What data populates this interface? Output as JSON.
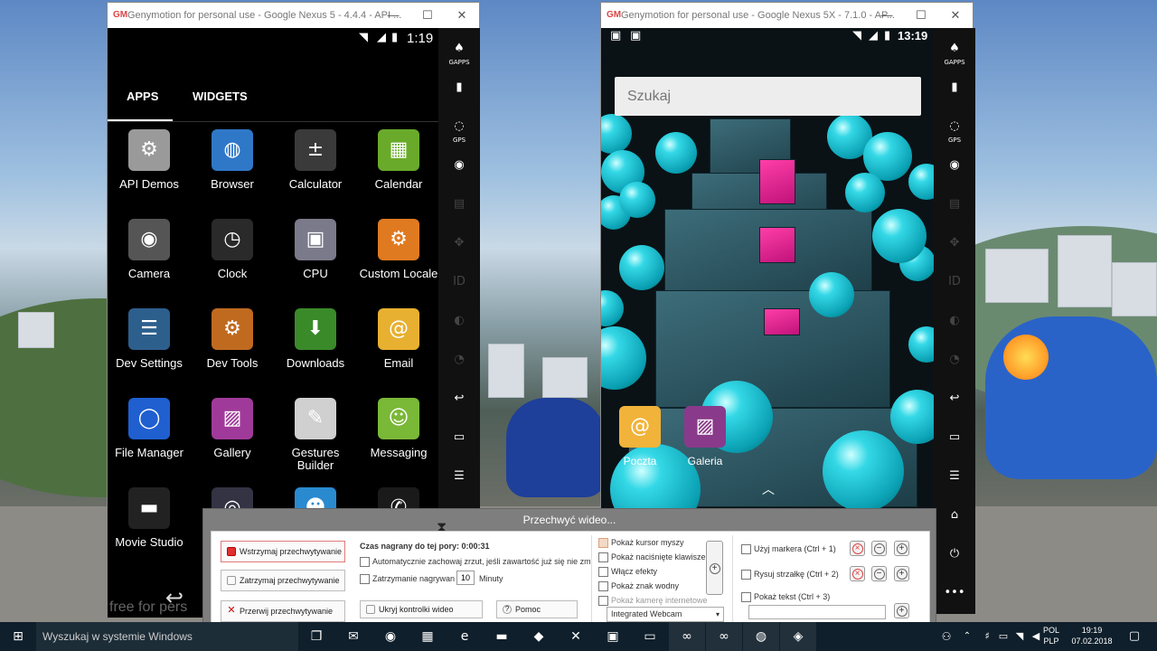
{
  "window_left": {
    "title": "Genymotion for personal use - Google Nexus 5 - 4.4.4 - API ...",
    "logo": "GM",
    "status_time": "1:19",
    "tabs": [
      "APPS",
      "WIDGETS"
    ],
    "apps": [
      {
        "label": "API Demos",
        "icon": "folder-gear-icon",
        "glyph": "⚙",
        "color": "#9a9a9a"
      },
      {
        "label": "Browser",
        "icon": "globe-icon",
        "glyph": "◍",
        "color": "#2f78c8"
      },
      {
        "label": "Calculator",
        "icon": "calculator-icon",
        "glyph": "±",
        "color": "#3a3a3a"
      },
      {
        "label": "Calendar",
        "icon": "calendar-icon",
        "glyph": "▦",
        "color": "#6aaa2a"
      },
      {
        "label": "Camera",
        "icon": "camera-icon",
        "glyph": "◉",
        "color": "#555"
      },
      {
        "label": "Clock",
        "icon": "clock-icon",
        "glyph": "◷",
        "color": "#2a2a2a"
      },
      {
        "label": "CPU",
        "icon": "cpu-icon",
        "glyph": "▣",
        "color": "#7a7a8a"
      },
      {
        "label": "Custom Locale",
        "icon": "locale-gear-icon",
        "glyph": "⚙",
        "color": "#e07a20"
      },
      {
        "label": "Dev Settings",
        "icon": "sliders-icon",
        "glyph": "☰",
        "color": "#2d5f8d"
      },
      {
        "label": "Dev Tools",
        "icon": "gear-icon",
        "glyph": "⚙",
        "color": "#c06a20"
      },
      {
        "label": "Downloads",
        "icon": "download-icon",
        "glyph": "⬇",
        "color": "#3a8a2a"
      },
      {
        "label": "Email",
        "icon": "email-icon",
        "glyph": "@",
        "color": "#e8b030"
      },
      {
        "label": "File Manager",
        "icon": "file-manager-icon",
        "glyph": "◯",
        "color": "#1f5fd0"
      },
      {
        "label": "Gallery",
        "icon": "gallery-icon",
        "glyph": "▨",
        "color": "#a03a9a"
      },
      {
        "label": "Gestures Builder",
        "icon": "gesture-icon",
        "glyph": "✎",
        "color": "#d0d0d0"
      },
      {
        "label": "Messaging",
        "icon": "messaging-icon",
        "glyph": "☺",
        "color": "#7ab838"
      },
      {
        "label": "Movie Studio",
        "icon": "clapperboard-icon",
        "glyph": "▬",
        "color": "#222"
      },
      {
        "label": "",
        "icon": "music-icon",
        "glyph": "◎",
        "color": "#334"
      },
      {
        "label": "",
        "icon": "contacts-icon",
        "glyph": "☻",
        "color": "#2a8ad0"
      },
      {
        "label": "",
        "icon": "phone-icon",
        "glyph": "✆",
        "color": "#1a1a1a"
      }
    ],
    "watermark": "free for pers",
    "sidebar": [
      {
        "icon": "gapps-icon",
        "glyph": "♠",
        "sub": "GAPPS",
        "dim": false
      },
      {
        "icon": "battery-icon",
        "glyph": "▮",
        "sub": "",
        "dim": false
      },
      {
        "icon": "gps-icon",
        "glyph": "◌",
        "sub": "GPS",
        "dim": false
      },
      {
        "icon": "webcam-icon",
        "glyph": "◉",
        "sub": "",
        "dim": false
      },
      {
        "icon": "clapper-icon",
        "glyph": "▤",
        "sub": "",
        "dim": true
      },
      {
        "icon": "dpad-icon",
        "glyph": "✥",
        "sub": "",
        "dim": true
      },
      {
        "icon": "id-icon",
        "glyph": "ID",
        "sub": "",
        "dim": true
      },
      {
        "icon": "disk-icon",
        "glyph": "◐",
        "sub": "",
        "dim": true
      },
      {
        "icon": "cast-icon",
        "glyph": "◔",
        "sub": "",
        "dim": true
      },
      {
        "icon": "back-icon",
        "glyph": "↩",
        "sub": "",
        "dim": false
      },
      {
        "icon": "recent-apps-icon",
        "glyph": "▭",
        "sub": "",
        "dim": false
      },
      {
        "icon": "menu-icon",
        "glyph": "☰",
        "sub": "",
        "dim": false
      }
    ]
  },
  "window_right": {
    "title": "Genymotion for personal use - Google Nexus 5X - 7.1.0 - AP...",
    "logo": "GM",
    "status_time": "13:19",
    "search_placeholder": "Szukaj",
    "dock": [
      {
        "label": "Poczta",
        "icon": "mail-icon",
        "glyph": "@",
        "color": "#f1b33a"
      },
      {
        "label": "Galeria",
        "icon": "gallery-icon",
        "glyph": "▨",
        "color": "#8a3a8a"
      }
    ],
    "sidebar": [
      {
        "icon": "gapps-icon",
        "glyph": "♠",
        "sub": "GAPPS",
        "dim": false
      },
      {
        "icon": "battery-icon",
        "glyph": "▮",
        "sub": "",
        "dim": false
      },
      {
        "icon": "gps-icon",
        "glyph": "◌",
        "sub": "GPS",
        "dim": false
      },
      {
        "icon": "webcam-icon",
        "glyph": "◉",
        "sub": "",
        "dim": false
      },
      {
        "icon": "clapper-icon",
        "glyph": "▤",
        "sub": "",
        "dim": true
      },
      {
        "icon": "dpad-icon",
        "glyph": "✥",
        "sub": "",
        "dim": true
      },
      {
        "icon": "id-icon",
        "glyph": "ID",
        "sub": "",
        "dim": true
      },
      {
        "icon": "disk-icon",
        "glyph": "◐",
        "sub": "",
        "dim": true
      },
      {
        "icon": "cast-icon",
        "glyph": "◔",
        "sub": "",
        "dim": true
      },
      {
        "icon": "back-icon",
        "glyph": "↩",
        "sub": "",
        "dim": false
      },
      {
        "icon": "recent-apps-icon",
        "glyph": "▭",
        "sub": "",
        "dim": false
      },
      {
        "icon": "menu-icon",
        "glyph": "☰",
        "sub": "",
        "dim": false
      },
      {
        "icon": "home-icon",
        "glyph": "⌂",
        "sub": "",
        "dim": false
      },
      {
        "icon": "power-icon",
        "glyph": "⏻",
        "sub": "",
        "dim": false
      },
      {
        "icon": "more-icon",
        "glyph": "•••",
        "sub": "",
        "dim": false
      }
    ]
  },
  "dialog": {
    "title": "Przechwyć wideo...",
    "btn_pause": "Wstrzymaj przechwytywanie",
    "btn_stop": "Zatrzymaj przechwytywanie",
    "btn_abort": "Przerwij przechwytywanie",
    "recorded_label": "Czas nagrany do tej pory: 0:00:31",
    "auto_save": "Automatycznie zachowaj zrzut, jeśli zawartość już się nie zm",
    "stop_recording": "Zatrzymanie nagrywan",
    "minutes_value": "10",
    "minutes_unit": "Minuty",
    "hide_controls": "Ukryj kontrolki wideo",
    "help": "Pomoc",
    "opts": [
      {
        "label": "Pokaż kursor myszy",
        "checked": true,
        "disabled": false
      },
      {
        "label": "Pokaż naciśnięte klawisze",
        "checked": false,
        "disabled": false
      },
      {
        "label": "Włącz efekty",
        "checked": false,
        "disabled": false
      },
      {
        "label": "Pokaż znak wodny",
        "checked": false,
        "disabled": false
      },
      {
        "label": "Pokaż kamerę internetowe",
        "checked": false,
        "disabled": true
      }
    ],
    "webcam_select": "Integrated Webcam",
    "marker": "Użyj markera (Ctrl + 1)",
    "arrow": "Rysuj strzałkę (Ctrl + 2)",
    "text": "Pokaż tekst (Ctrl + 3)"
  },
  "taskbar": {
    "search_placeholder": "Wyszukaj w systemie Windows",
    "lang_top": "POL",
    "lang_bottom": "PLP",
    "time": "19:19",
    "date": "07.02.2018",
    "pinned": [
      {
        "icon": "task-view-icon",
        "glyph": "❐"
      },
      {
        "icon": "mail-app-icon",
        "glyph": "✉"
      },
      {
        "icon": "firefox-icon",
        "glyph": "◉"
      },
      {
        "icon": "calculator-app-icon",
        "glyph": "▦"
      },
      {
        "icon": "edge-icon",
        "glyph": "e"
      },
      {
        "icon": "explorer-icon",
        "glyph": "▬"
      },
      {
        "icon": "game-icon",
        "glyph": "◆"
      },
      {
        "icon": "tools-icon",
        "glyph": "✕"
      },
      {
        "icon": "screen-icon",
        "glyph": "▣"
      },
      {
        "icon": "folder-icon",
        "glyph": "▭"
      },
      {
        "icon": "genymotion-icon",
        "glyph": "∞"
      },
      {
        "icon": "genymotion-app-icon",
        "glyph": "∞"
      },
      {
        "icon": "chrome-icon",
        "glyph": "◍"
      },
      {
        "icon": "recorder-icon",
        "glyph": "◈"
      }
    ]
  }
}
